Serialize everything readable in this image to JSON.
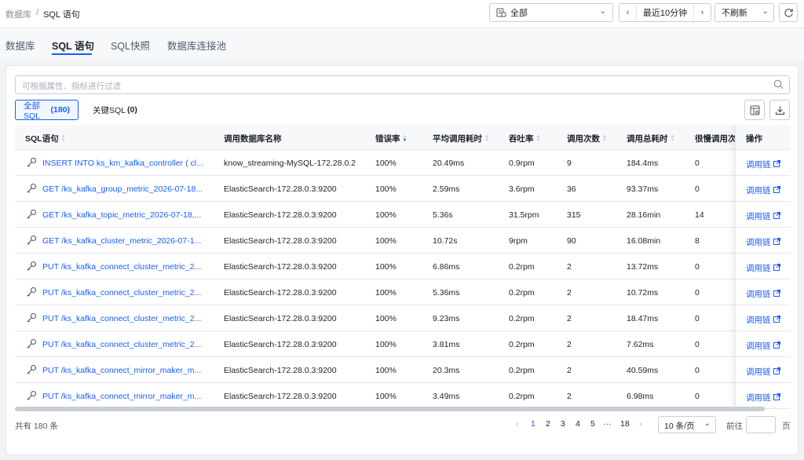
{
  "breadcrumb": {
    "root": "数据库",
    "sep": "/",
    "current": "SQL 语句"
  },
  "toolbar": {
    "scope_select": "全部",
    "time_range": "最近10分钟",
    "refresh_select": "不刷新"
  },
  "tabs": [
    {
      "label": "数据库",
      "active": false
    },
    {
      "label": "SQL 语句",
      "active": true
    },
    {
      "label": "SQL快照",
      "active": false
    },
    {
      "label": "数据库连接池",
      "active": false
    }
  ],
  "filter": {
    "placeholder": "可根据属性、指标进行过滤"
  },
  "segments": {
    "all_label": "全部SQL",
    "all_count": "(180)",
    "key_label": "关键SQL",
    "key_count": "(0)"
  },
  "table": {
    "headers": {
      "sql": "SQL语句",
      "db": "调用数据库名称",
      "error_rate": "错误率",
      "avg_time": "平均调用耗时",
      "throughput": "吞吐率",
      "calls": "调用次数",
      "total_time": "调用总耗时",
      "slow_calls": "很慢调用次数",
      "ops": "操作"
    },
    "rows": [
      {
        "sql": "INSERT INTO ks_km_kafka_controller ( cl...",
        "db": "know_streaming-MySQL-172.28.0.2",
        "error_rate": "100%",
        "avg_time": "20.49ms",
        "throughput": "0.9rpm",
        "calls": "9",
        "total_time": "184.4ms",
        "slow_calls": "0",
        "op": "调用链"
      },
      {
        "sql": "GET /ks_kafka_group_metric_2026-07-18...",
        "db": "ElasticSearch-172.28.0.3:9200",
        "error_rate": "100%",
        "avg_time": "2.59ms",
        "throughput": "3.6rpm",
        "calls": "36",
        "total_time": "93.37ms",
        "slow_calls": "0",
        "op": "调用链"
      },
      {
        "sql": "GET /ks_kafka_topic_metric_2026-07-18,...",
        "db": "ElasticSearch-172.28.0.3:9200",
        "error_rate": "100%",
        "avg_time": "5.36s",
        "throughput": "31.5rpm",
        "calls": "315",
        "total_time": "28.16min",
        "slow_calls": "14",
        "op": "调用链"
      },
      {
        "sql": "GET /ks_kafka_cluster_metric_2026-07-1...",
        "db": "ElasticSearch-172.28.0.3:9200",
        "error_rate": "100%",
        "avg_time": "10.72s",
        "throughput": "9rpm",
        "calls": "90",
        "total_time": "16.08min",
        "slow_calls": "8",
        "op": "调用链"
      },
      {
        "sql": "PUT /ks_kafka_connect_cluster_metric_2...",
        "db": "ElasticSearch-172.28.0.3:9200",
        "error_rate": "100%",
        "avg_time": "6.86ms",
        "throughput": "0.2rpm",
        "calls": "2",
        "total_time": "13.72ms",
        "slow_calls": "0",
        "op": "调用链"
      },
      {
        "sql": "PUT /ks_kafka_connect_cluster_metric_2...",
        "db": "ElasticSearch-172.28.0.3:9200",
        "error_rate": "100%",
        "avg_time": "5.36ms",
        "throughput": "0.2rpm",
        "calls": "2",
        "total_time": "10.72ms",
        "slow_calls": "0",
        "op": "调用链"
      },
      {
        "sql": "PUT /ks_kafka_connect_cluster_metric_2...",
        "db": "ElasticSearch-172.28.0.3:9200",
        "error_rate": "100%",
        "avg_time": "9.23ms",
        "throughput": "0.2rpm",
        "calls": "2",
        "total_time": "18.47ms",
        "slow_calls": "0",
        "op": "调用链"
      },
      {
        "sql": "PUT /ks_kafka_connect_cluster_metric_2...",
        "db": "ElasticSearch-172.28.0.3:9200",
        "error_rate": "100%",
        "avg_time": "3.81ms",
        "throughput": "0.2rpm",
        "calls": "2",
        "total_time": "7.62ms",
        "slow_calls": "0",
        "op": "调用链"
      },
      {
        "sql": "PUT /ks_kafka_connect_mirror_maker_m...",
        "db": "ElasticSearch-172.28.0.3:9200",
        "error_rate": "100%",
        "avg_time": "20.3ms",
        "throughput": "0.2rpm",
        "calls": "2",
        "total_time": "40.59ms",
        "slow_calls": "0",
        "op": "调用链"
      },
      {
        "sql": "PUT /ks_kafka_connect_mirror_maker_m...",
        "db": "ElasticSearch-172.28.0.3:9200",
        "error_rate": "100%",
        "avg_time": "3.49ms",
        "throughput": "0.2rpm",
        "calls": "2",
        "total_time": "6.98ms",
        "slow_calls": "0",
        "op": "调用链"
      }
    ]
  },
  "footer": {
    "total": "共有 180 条",
    "pages": [
      "1",
      "2",
      "3",
      "4",
      "5",
      "···",
      "18"
    ],
    "current_page": "1",
    "page_size": "10 条/页",
    "goto_label": "前往",
    "goto_suffix": "页"
  },
  "colors": {
    "accent": "#165dff",
    "border": "#e5e6eb",
    "header_bg": "#f7f8fa"
  }
}
